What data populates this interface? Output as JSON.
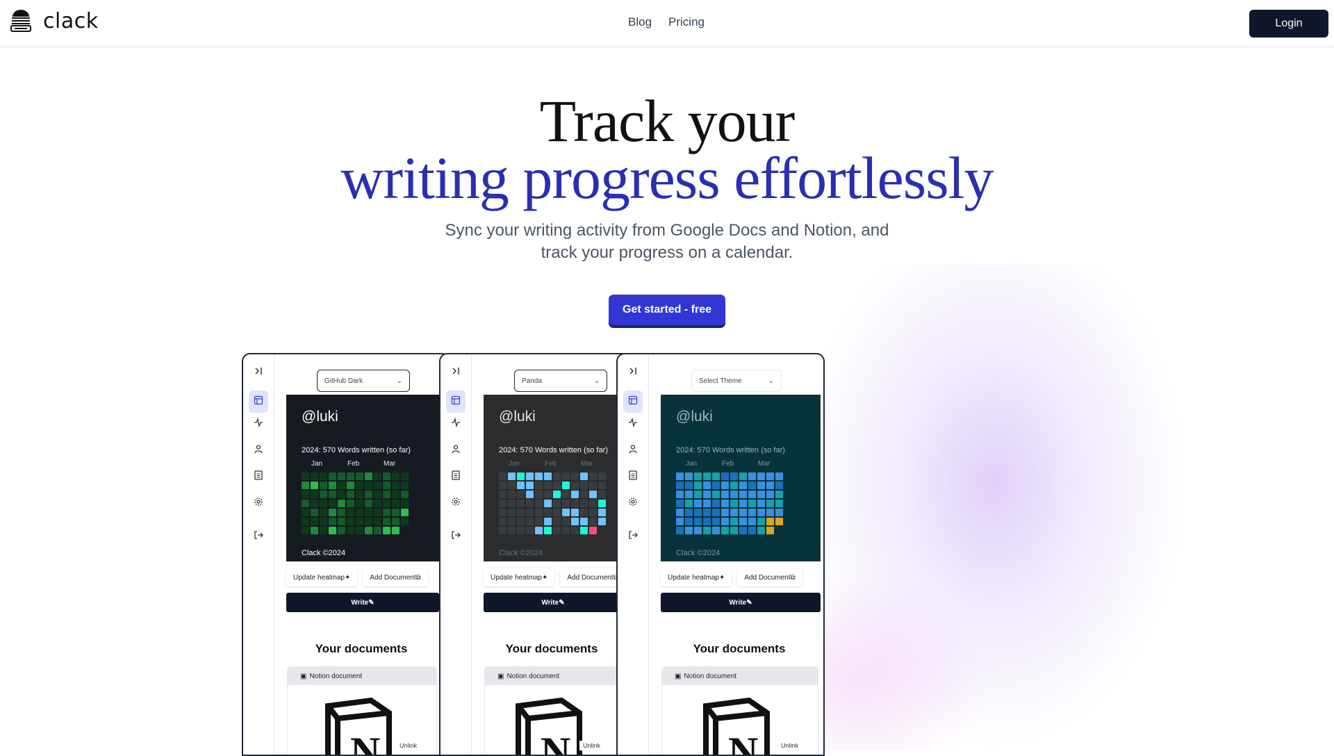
{
  "header": {
    "brand": "clack",
    "nav": [
      "Blog",
      "Pricing"
    ],
    "login_label": "Login"
  },
  "hero": {
    "line1": "Track your",
    "line2": "writing progress effortlessly",
    "subtitle_line1": "Sync your writing activity from Google Docs and Notion, and",
    "subtitle_line2": "track your progress on a calendar.",
    "cta_label": "Get started - free"
  },
  "cards": [
    {
      "theme": "GitHub Dark",
      "handle": "@luki",
      "words": "2024: 570 Words written (so far)",
      "months": [
        "Jan",
        "Feb",
        "Mar"
      ],
      "copyright": "Clack ©2024",
      "update_label": "Update heatmap",
      "add_label": "Add Document",
      "write_label": "Write",
      "docs_title": "Your documents",
      "doc_type": "Notion document",
      "unlink_label": "Unlink",
      "panel_bg": "#161b22",
      "cell_colors": [
        "#0e3a1c",
        "#145c2a",
        "#1f8a3c",
        "#2ebd4e"
      ]
    },
    {
      "theme": "Panda",
      "handle": "@luki",
      "words": "2024: 570 Words written (so far)",
      "months": [
        "Jan",
        "Feb",
        "Mar"
      ],
      "copyright": "Clack ©2024",
      "update_label": "Update heatmap",
      "add_label": "Add Document",
      "write_label": "Write",
      "docs_title": "Your documents",
      "doc_type": "Notion document",
      "unlink_label": "Unlink",
      "panel_bg": "#2a2c2d",
      "cell_colors": [
        "#3a3d40",
        "#6fc1ff",
        "#19f9d8",
        "#ff4b82"
      ]
    },
    {
      "theme": "Select Theme",
      "handle": "@luki",
      "words": "2024: 570 Words written (so far)",
      "months": [
        "Jan",
        "Feb",
        "Mar"
      ],
      "copyright": "Clack ©2024",
      "update_label": "Update heatmap",
      "add_label": "Add Document",
      "write_label": "Write",
      "docs_title": "Your documents",
      "doc_type": "Notion document",
      "unlink_label": "Unlink",
      "panel_bg": "#06343a",
      "cell_colors": [
        "#1d6fb8",
        "#3b8fe0",
        "#16a0a8",
        "#e0a51a",
        "#e0407a"
      ]
    }
  ],
  "sidebar_icons": [
    "collapse-icon",
    "layout-icon",
    "activity-icon",
    "user-icon",
    "document-icon",
    "settings-icon",
    "logout-icon"
  ],
  "colors": {
    "accent": "#3236d4",
    "hero_blue": "#2a2fb0",
    "dark": "#0f172a"
  }
}
